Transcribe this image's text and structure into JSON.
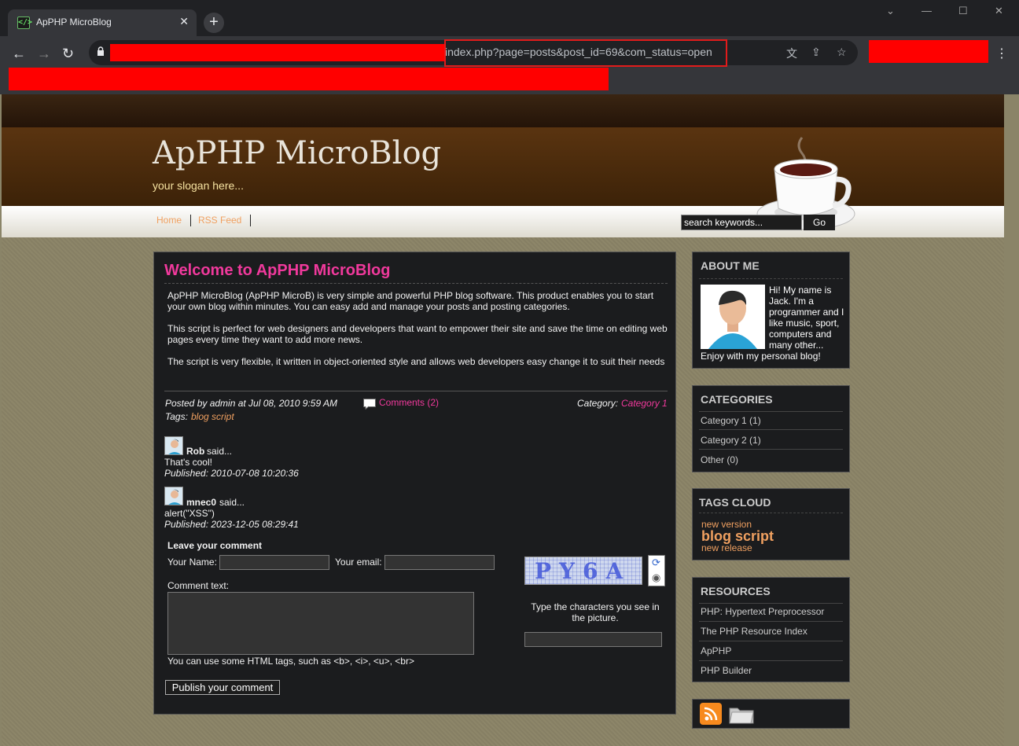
{
  "browser": {
    "tab_title": "ApPHP MicroBlog",
    "url_visible": "index.php?page=posts&post_id=69&com_status=open"
  },
  "site": {
    "title": "ApPHP MicroBlog",
    "slogan": "your slogan here...",
    "nav": [
      "Home",
      "RSS Feed"
    ],
    "search_placeholder": "search keywords...",
    "search_button": "Go"
  },
  "post": {
    "title": "Welcome to ApPHP MicroBlog",
    "paragraphs": [
      "ApPHP MicroBlog (ApPHP MicroB) is very simple and powerful PHP blog software. This product enables you to start your own blog within minutes. You can easy add and manage your posts and posting categories.",
      "This script is perfect for web designers and developers that want to empower their site and save the time on editing web pages every time they want to add more news.",
      "The script is very flexible, it written in object-oriented style and allows web developers easy change it to suit their needs"
    ],
    "posted_by": "Posted by admin at Jul 08, 2010 9:59 AM",
    "comments_link": "Comments (2)",
    "category_label": "Category:",
    "category_value": "Category 1",
    "tags_label": "Tags:",
    "tags_value": "blog script"
  },
  "comments": [
    {
      "author": "Rob",
      "said": "said...",
      "text": "That's cool!",
      "published": "Published: 2010-07-08 10:20:36"
    },
    {
      "author": "mnec0",
      "said": "said...",
      "text": "alert(\"XSS\")",
      "published": "Published: 2023-12-05 08:29:41"
    }
  ],
  "form": {
    "heading": "Leave your comment",
    "name_label": "Your Name:",
    "email_label": "Your email:",
    "comment_label": "Comment text:",
    "html_hint": "You can use some HTML tags, such as <b>, <i>, <u>, <br>",
    "captcha_text": "PY6A",
    "captcha_hint": "Type the characters you see in the picture.",
    "submit": "Publish your comment"
  },
  "sidebar": {
    "about": {
      "title": "ABOUT ME",
      "text": "Hi! My name is Jack. I'm a programmer and I like music, sport, computers and many other...",
      "text2": "Enjoy with my personal blog!"
    },
    "categories": {
      "title": "CATEGORIES",
      "items": [
        "Category 1 (1)",
        "Category 2 (1)",
        "Other (0)"
      ]
    },
    "tags": {
      "title": "TAGS CLOUD",
      "items": [
        "new version",
        "blog script",
        "new release"
      ]
    },
    "resources": {
      "title": "RESOURCES",
      "items": [
        "PHP: Hypertext Preprocessor",
        "The PHP Resource Index",
        "ApPHP",
        "PHP Builder"
      ]
    }
  },
  "colors": {
    "accent_pink": "#f0399c",
    "link_orange": "#f0a060",
    "header_brown": "#5a3410"
  }
}
